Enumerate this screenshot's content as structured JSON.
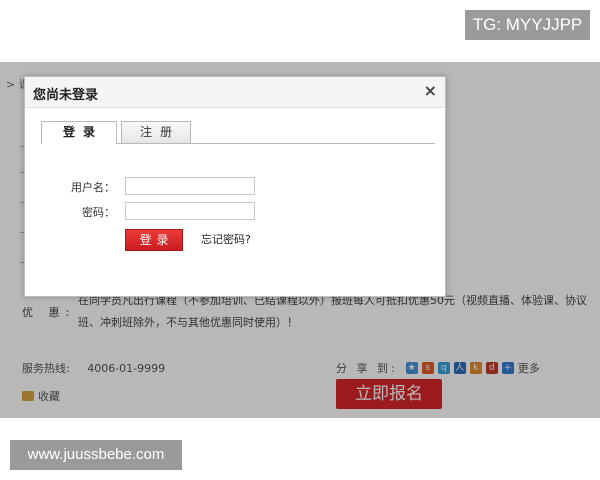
{
  "watermarks": {
    "top_right": "TG: MYYJJPP",
    "bottom_left": "www.juussbebe.com"
  },
  "background_page": {
    "breadcrumb": "> 课",
    "promo_label": "优 惠:",
    "promo_text": "在同学员凡出行课程（不参加培训、已结课程以外）报班每人可抵扣优惠50元（视频直播、体验课、协议班、冲刺班除外，不与其他优惠同时使用）！",
    "hotline_label": "服务热线:",
    "hotline_number": "4006-01-9999",
    "share_label": "分 享 到:",
    "share_more": "更多",
    "share_icons": [
      "star-icon",
      "sina-icon",
      "qzone-icon",
      "renren-icon",
      "kaixin-icon",
      "douban-icon",
      "plus-icon"
    ],
    "favorite_label": "收藏",
    "enroll_button": "立即报名",
    "colors": {
      "enroll": "#d9262c"
    }
  },
  "login_modal": {
    "title": "您尚未登录",
    "close_symbol": "×",
    "tabs": [
      {
        "label": "登录",
        "active": true
      },
      {
        "label": "注册",
        "active": false
      }
    ],
    "username_label": "用户名：",
    "username_value": "",
    "password_label": "密码：",
    "password_value": "",
    "login_button": "登录",
    "forgot_password": "忘记密码?",
    "colors": {
      "login_button": "#d82424"
    }
  }
}
